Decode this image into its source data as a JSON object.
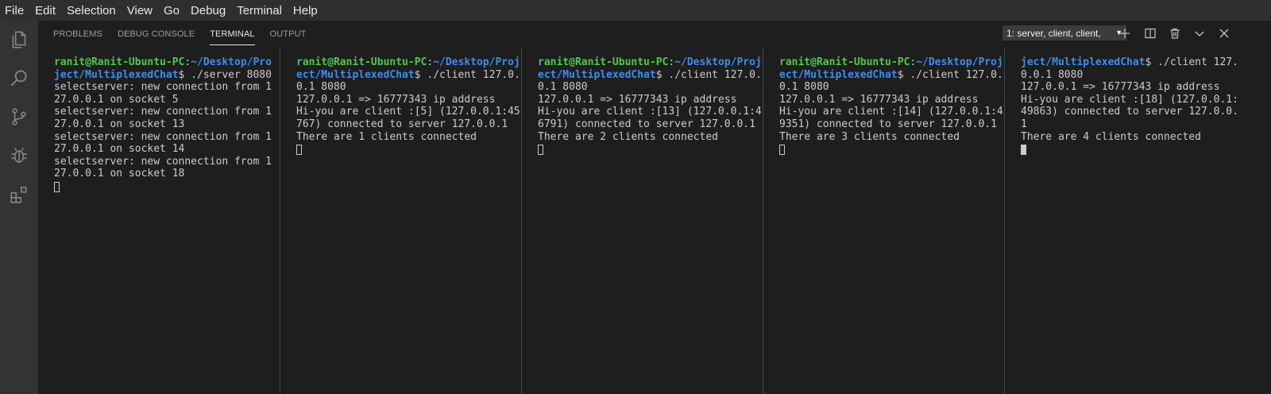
{
  "menubar": {
    "items": [
      "File",
      "Edit",
      "Selection",
      "View",
      "Go",
      "Debug",
      "Terminal",
      "Help"
    ]
  },
  "activitybar": {
    "icons": [
      "files-icon",
      "search-icon",
      "source-control-icon",
      "debug-icon",
      "extensions-icon"
    ]
  },
  "panel": {
    "tabs": [
      "PROBLEMS",
      "DEBUG CONSOLE",
      "TERMINAL",
      "OUTPUT"
    ],
    "active_tab": "TERMINAL",
    "terminal_select": "1: server, client, client,",
    "actions": [
      "add-icon",
      "split-icon",
      "trash-icon",
      "chevron-down-icon",
      "close-icon"
    ]
  },
  "terminals": [
    {
      "lines": [
        {
          "parts": [
            {
              "t": "ranit@Ranit-Ubuntu-PC",
              "c": "green"
            },
            {
              "t": ":",
              "c": ""
            },
            {
              "t": "~/Desktop/Pro",
              "c": "blue"
            }
          ]
        },
        {
          "parts": [
            {
              "t": "ject/MultiplexedChat",
              "c": "blue"
            },
            {
              "t": "$ ./server 8080",
              "c": ""
            }
          ]
        },
        {
          "parts": [
            {
              "t": "selectserver: new connection from 1",
              "c": ""
            }
          ]
        },
        {
          "parts": [
            {
              "t": "27.0.0.1 on socket 5",
              "c": ""
            }
          ]
        },
        {
          "parts": [
            {
              "t": "selectserver: new connection from 1",
              "c": ""
            }
          ]
        },
        {
          "parts": [
            {
              "t": "27.0.0.1 on socket 13",
              "c": ""
            }
          ]
        },
        {
          "parts": [
            {
              "t": "selectserver: new connection from 1",
              "c": ""
            }
          ]
        },
        {
          "parts": [
            {
              "t": "27.0.0.1 on socket 14",
              "c": ""
            }
          ]
        },
        {
          "parts": [
            {
              "t": "selectserver: new connection from 1",
              "c": ""
            }
          ]
        },
        {
          "parts": [
            {
              "t": "27.0.0.1 on socket 18",
              "c": ""
            }
          ]
        }
      ],
      "cursor": "outline"
    },
    {
      "lines": [
        {
          "parts": [
            {
              "t": "ranit@Ranit-Ubuntu-PC",
              "c": "green"
            },
            {
              "t": ":",
              "c": ""
            },
            {
              "t": "~/Desktop/Proj",
              "c": "blue"
            }
          ]
        },
        {
          "parts": [
            {
              "t": "ect/MultiplexedChat",
              "c": "blue"
            },
            {
              "t": "$ ./client 127.0.",
              "c": ""
            }
          ]
        },
        {
          "parts": [
            {
              "t": "0.1 8080",
              "c": ""
            }
          ]
        },
        {
          "parts": [
            {
              "t": "127.0.0.1 => 16777343 ip address",
              "c": ""
            }
          ]
        },
        {
          "parts": [
            {
              "t": "Hi-you are client :[5] (127.0.0.1:45",
              "c": ""
            }
          ]
        },
        {
          "parts": [
            {
              "t": "767) connected to server 127.0.0.1",
              "c": ""
            }
          ]
        },
        {
          "parts": [
            {
              "t": "There are 1 clients connected",
              "c": ""
            }
          ]
        }
      ],
      "cursor": "outline"
    },
    {
      "lines": [
        {
          "parts": [
            {
              "t": "ranit@Ranit-Ubuntu-PC",
              "c": "green"
            },
            {
              "t": ":",
              "c": ""
            },
            {
              "t": "~/Desktop/Proj",
              "c": "blue"
            }
          ]
        },
        {
          "parts": [
            {
              "t": "ect/MultiplexedChat",
              "c": "blue"
            },
            {
              "t": "$ ./client 127.0.",
              "c": ""
            }
          ]
        },
        {
          "parts": [
            {
              "t": "0.1 8080",
              "c": ""
            }
          ]
        },
        {
          "parts": [
            {
              "t": "127.0.0.1 => 16777343 ip address",
              "c": ""
            }
          ]
        },
        {
          "parts": [
            {
              "t": "Hi-you are client :[13] (127.0.0.1:4",
              "c": ""
            }
          ]
        },
        {
          "parts": [
            {
              "t": "6791) connected to server 127.0.0.1",
              "c": ""
            }
          ]
        },
        {
          "parts": [
            {
              "t": "There are 2 clients connected",
              "c": ""
            }
          ]
        }
      ],
      "cursor": "outline"
    },
    {
      "lines": [
        {
          "parts": [
            {
              "t": "ranit@Ranit-Ubuntu-PC",
              "c": "green"
            },
            {
              "t": ":",
              "c": ""
            },
            {
              "t": "~/Desktop/Proj",
              "c": "blue"
            }
          ]
        },
        {
          "parts": [
            {
              "t": "ect/MultiplexedChat",
              "c": "blue"
            },
            {
              "t": "$ ./client 127.0.",
              "c": ""
            }
          ]
        },
        {
          "parts": [
            {
              "t": "0.1 8080",
              "c": ""
            }
          ]
        },
        {
          "parts": [
            {
              "t": "127.0.0.1 => 16777343 ip address",
              "c": ""
            }
          ]
        },
        {
          "parts": [
            {
              "t": "Hi-you are client :[14] (127.0.0.1:4",
              "c": ""
            }
          ]
        },
        {
          "parts": [
            {
              "t": "9351) connected to server 127.0.0.1",
              "c": ""
            }
          ]
        },
        {
          "parts": [
            {
              "t": "There are 3 clients connected",
              "c": ""
            }
          ]
        }
      ],
      "cursor": "outline"
    },
    {
      "lines": [
        {
          "parts": [
            {
              "t": "ject/MultiplexedChat",
              "c": "blue"
            },
            {
              "t": "$ ./client 127.",
              "c": ""
            }
          ]
        },
        {
          "parts": [
            {
              "t": "0.0.1 8080",
              "c": ""
            }
          ]
        },
        {
          "parts": [
            {
              "t": "127.0.0.1 => 16777343 ip address",
              "c": ""
            }
          ]
        },
        {
          "parts": [
            {
              "t": "Hi-you are client :[18] (127.0.0.1:",
              "c": ""
            }
          ]
        },
        {
          "parts": [
            {
              "t": "49863) connected to server 127.0.0.",
              "c": ""
            }
          ]
        },
        {
          "parts": [
            {
              "t": "1",
              "c": ""
            }
          ]
        },
        {
          "parts": [
            {
              "t": "There are 4 clients connected",
              "c": ""
            }
          ]
        }
      ],
      "cursor": "filled"
    }
  ]
}
